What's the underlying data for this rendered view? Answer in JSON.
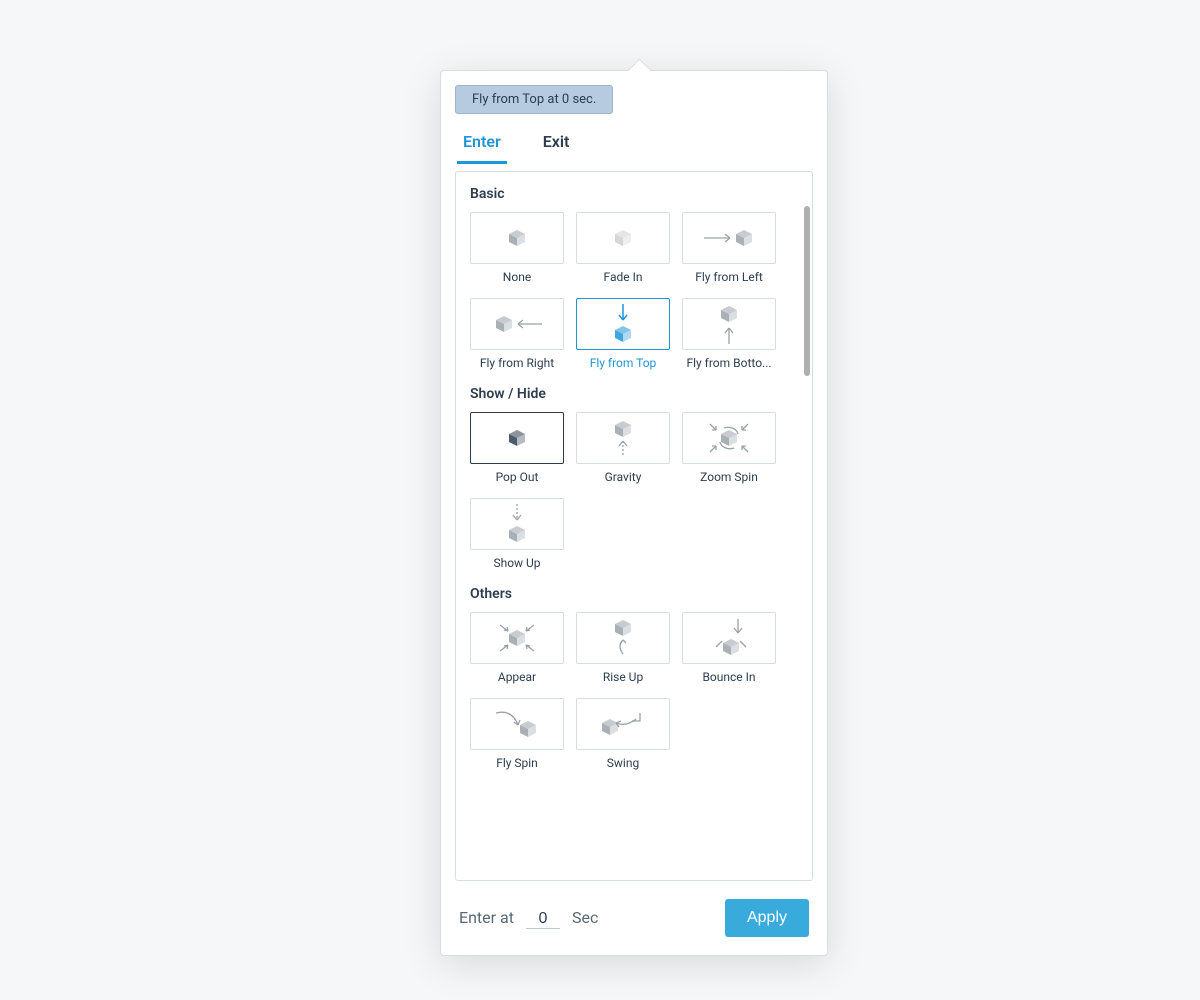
{
  "chip_label": "Fly from Top at 0 sec.",
  "tabs": {
    "enter": "Enter",
    "exit": "Exit",
    "active": "enter"
  },
  "sections": {
    "basic": {
      "title": "Basic",
      "items": [
        {
          "label": "None"
        },
        {
          "label": "Fade In"
        },
        {
          "label": "Fly from Left"
        },
        {
          "label": "Fly from Right"
        },
        {
          "label": "Fly from Top",
          "selected": true
        },
        {
          "label": "Fly from Botto..."
        }
      ]
    },
    "showhide": {
      "title": "Show / Hide",
      "items": [
        {
          "label": "Pop Out",
          "focus": true
        },
        {
          "label": "Gravity"
        },
        {
          "label": "Zoom Spin"
        },
        {
          "label": "Show Up"
        }
      ]
    },
    "others": {
      "title": "Others",
      "items": [
        {
          "label": "Appear"
        },
        {
          "label": "Rise Up"
        },
        {
          "label": "Bounce In"
        },
        {
          "label": "Fly Spin"
        },
        {
          "label": "Swing"
        }
      ]
    }
  },
  "footer": {
    "enter_at_label": "Enter at",
    "enter_at_value": "0",
    "enter_at_unit": "Sec",
    "apply_label": "Apply"
  }
}
